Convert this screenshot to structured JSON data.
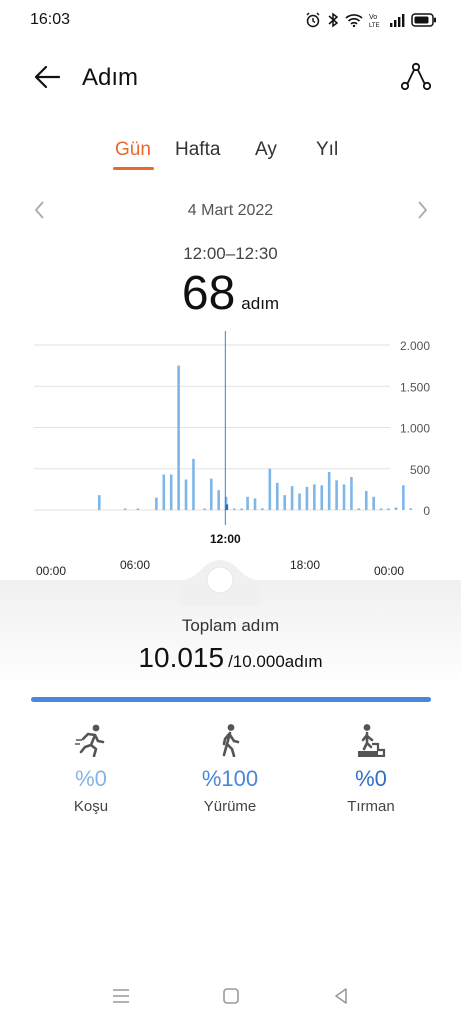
{
  "status_bar": {
    "time": "16:03",
    "icons": [
      "alarm-icon",
      "bluetooth-icon",
      "wifi-icon",
      "volte-icon",
      "signal-icon",
      "battery-icon"
    ]
  },
  "app_bar": {
    "title": "Adım",
    "back_icon": "back-arrow-icon",
    "share_icon": "share-route-icon"
  },
  "tabs": [
    {
      "label": "Gün",
      "active": true
    },
    {
      "label": "Hafta",
      "active": false
    },
    {
      "label": "Ay",
      "active": false
    },
    {
      "label": "Yıl",
      "active": false
    }
  ],
  "date_nav": {
    "date": "4 Mart 2022",
    "prev_icon": "chevron-left-icon",
    "next_icon": "chevron-right-icon"
  },
  "selection": {
    "range": "12:00–12:30",
    "value": "68",
    "unit": "adım"
  },
  "chart_data": {
    "type": "bar",
    "title": "",
    "x_unit": "time of day",
    "x_ticks": [
      "00:00",
      "06:00",
      "12:00",
      "18:00",
      "00:00"
    ],
    "y_ticks": [
      "2.000",
      "1.500",
      "1.000",
      "500",
      "0"
    ],
    "ylim": [
      0,
      2000
    ],
    "grid": true,
    "selected_label": "12:00",
    "bar_color": "#7fb6e8",
    "selected_color": "#1d6fc2",
    "bars": [
      {
        "t": 8.8,
        "v": 180
      },
      {
        "t": 12.3,
        "v": 15
      },
      {
        "t": 14.0,
        "v": 10
      },
      {
        "t": 16.5,
        "v": 150
      },
      {
        "t": 17.5,
        "v": 430
      },
      {
        "t": 18.5,
        "v": 430
      },
      {
        "t": 19.5,
        "v": 1750
      },
      {
        "t": 20.5,
        "v": 370
      },
      {
        "t": 21.5,
        "v": 620
      },
      {
        "t": 23.0,
        "v": 10
      },
      {
        "t": 23.9,
        "v": 380
      },
      {
        "t": 24.9,
        "v": 240
      },
      {
        "t": 25.9,
        "v": 160
      },
      {
        "t": 26.0,
        "v": 68,
        "selected": true
      },
      {
        "t": 27.0,
        "v": 10
      },
      {
        "t": 28.0,
        "v": 5
      },
      {
        "t": 28.8,
        "v": 160
      },
      {
        "t": 29.8,
        "v": 140
      },
      {
        "t": 30.8,
        "v": 20
      },
      {
        "t": 31.8,
        "v": 500
      },
      {
        "t": 32.8,
        "v": 330
      },
      {
        "t": 33.8,
        "v": 180
      },
      {
        "t": 34.8,
        "v": 290
      },
      {
        "t": 35.8,
        "v": 200
      },
      {
        "t": 36.8,
        "v": 280
      },
      {
        "t": 37.8,
        "v": 310
      },
      {
        "t": 38.8,
        "v": 300
      },
      {
        "t": 39.8,
        "v": 460
      },
      {
        "t": 40.8,
        "v": 360
      },
      {
        "t": 41.8,
        "v": 310
      },
      {
        "t": 42.8,
        "v": 400
      },
      {
        "t": 43.8,
        "v": 15
      },
      {
        "t": 44.8,
        "v": 230
      },
      {
        "t": 45.8,
        "v": 160
      },
      {
        "t": 46.8,
        "v": 10
      },
      {
        "t": 47.8,
        "v": 10
      },
      {
        "t": 48.8,
        "v": 30
      },
      {
        "t": 49.8,
        "v": 300
      },
      {
        "t": 50.8,
        "v": 20
      }
    ]
  },
  "summary": {
    "label": "Toplam adım",
    "total": "10.015",
    "goal": "/10.000adım",
    "progress_fraction": 1.0
  },
  "activities": [
    {
      "name": "running",
      "icon": "running-icon",
      "percent": "%0",
      "label": "Koşu",
      "color": "#86b4e6"
    },
    {
      "name": "walking",
      "icon": "walking-icon",
      "percent": "%100",
      "label": "Yürüme",
      "color": "#4a86d9"
    },
    {
      "name": "climbing",
      "icon": "climbing-icon",
      "percent": "%0",
      "label": "Tırman",
      "color": "#2f6fc7"
    }
  ],
  "nav_bar": {
    "icons": [
      "menu-icon",
      "home-icon",
      "back-icon"
    ]
  }
}
